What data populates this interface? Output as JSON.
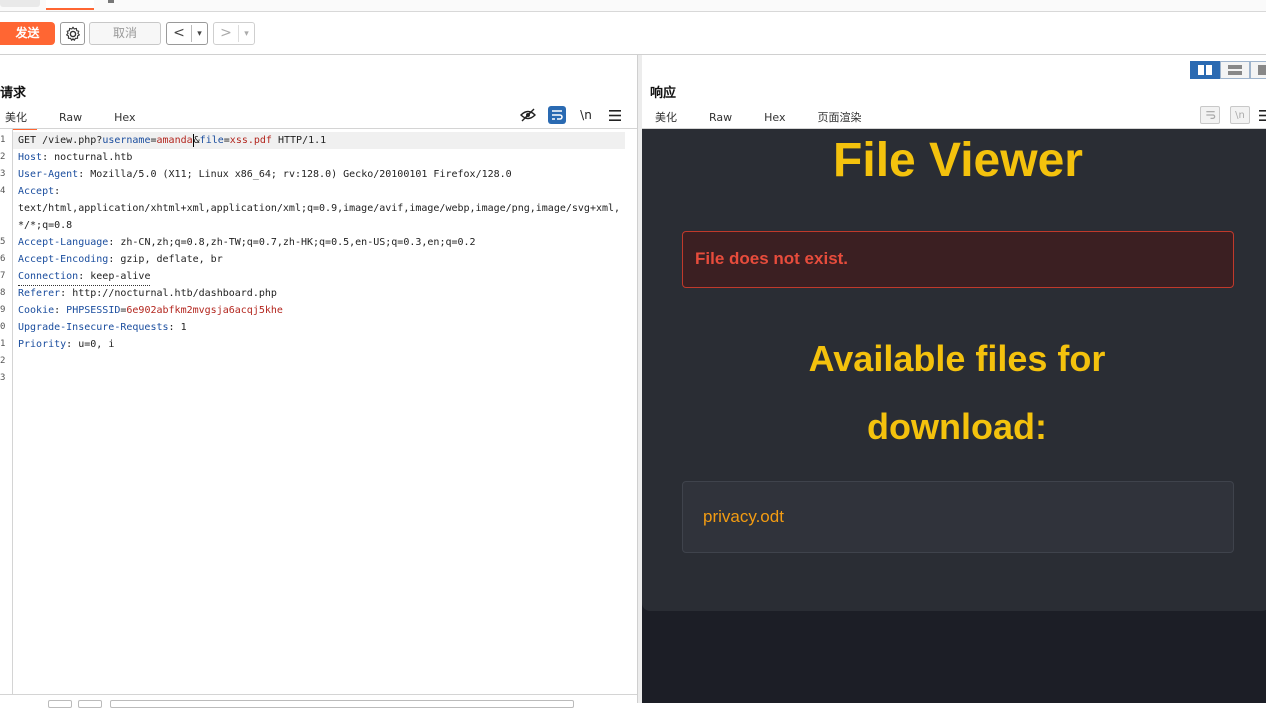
{
  "toolbar": {
    "send_label": "发送",
    "cancel_label": "取消",
    "back_symbol": "<",
    "forward_symbol": ">",
    "dropdown_symbol": "▾"
  },
  "request": {
    "title": "请求",
    "tabs": [
      "美化",
      "Raw",
      "Hex"
    ],
    "active_tab": "美化",
    "newline_icon_text": "\\n",
    "lines": [
      {
        "n": "1"
      },
      {
        "n": "2"
      },
      {
        "n": "3"
      },
      {
        "n": "4"
      },
      {
        "n": ""
      },
      {
        "n": ""
      },
      {
        "n": "5"
      },
      {
        "n": "6"
      },
      {
        "n": "7"
      },
      {
        "n": "8"
      },
      {
        "n": "9"
      },
      {
        "n": "0"
      },
      {
        "n": "1"
      },
      {
        "n": "2"
      },
      {
        "n": "3"
      }
    ],
    "method": "GET",
    "path": "/view.php?",
    "param1_key": "username",
    "param1_val": "amanda",
    "param2_key": "file",
    "param2_val": "xss.pdf",
    "protocol": "HTTP/1.1",
    "headers": {
      "host_k": "Host",
      "host_v": "nocturnal.htb",
      "ua_k": "User-Agent",
      "ua_v": "Mozilla/5.0 (X11; Linux x86_64; rv:128.0) Gecko/20100101 Firefox/128.0",
      "accept_k": "Accept",
      "accept_v1": "text/html,application/xhtml+xml,application/xml;q=0.9,image/avif,image/webp,image/png,image/svg+xml,",
      "accept_v2": "*/*;q=0.8",
      "lang_k": "Accept-Language",
      "lang_v": "zh-CN,zh;q=0.8,zh-TW;q=0.7,zh-HK;q=0.5,en-US;q=0.3,en;q=0.2",
      "enc_k": "Accept-Encoding",
      "enc_v": "gzip, deflate, br",
      "conn_k": "Connection",
      "conn_v": "keep-alive",
      "ref_k": "Referer",
      "ref_v": "http://nocturnal.htb/dashboard.php",
      "cookie_k": "Cookie",
      "cookie_name": "PHPSESSID",
      "cookie_val": "6e902abfkm2mvgsja6acqj5khe",
      "uir_k": "Upgrade-Insecure-Requests",
      "uir_v": "1",
      "prio_k": "Priority",
      "prio_v": "u=0, i"
    }
  },
  "response": {
    "title": "响应",
    "tabs": [
      "美化",
      "Raw",
      "Hex",
      "页面渲染"
    ],
    "active_tab": "页面渲染",
    "newline_icon_text": "\\n",
    "rendered": {
      "heading": "File Viewer",
      "error": "File does not exist.",
      "subheading_line1": "Available files for",
      "subheading_line2": "download:",
      "file": "privacy.odt"
    }
  },
  "colors": {
    "accent": "#ff6633",
    "blue": "#2a6ab2",
    "render_bg": "#1c1e26",
    "render_card": "#2a2d34",
    "heading_yellow": "#f4c20d",
    "error_red": "#e74c3c",
    "file_orange": "#f39c12"
  }
}
